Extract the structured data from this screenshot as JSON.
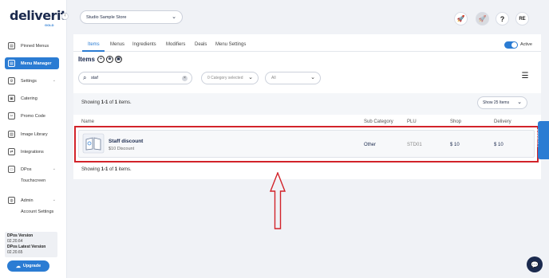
{
  "brand": {
    "name": "deliverit",
    "sub": "GOLD"
  },
  "sidebar": {
    "collapse_icon": "‹",
    "items": [
      {
        "label": "Pinned Menus",
        "icon": "▤"
      },
      {
        "label": "Menu Manager",
        "icon": "▤"
      },
      {
        "label": "Settings",
        "icon": "⚙"
      },
      {
        "label": "Catering",
        "icon": "▣"
      },
      {
        "label": "Promo Code",
        "icon": "✂"
      },
      {
        "label": "Image Library",
        "icon": "▧"
      },
      {
        "label": "Integrations",
        "icon": "⇄"
      },
      {
        "label": "DPos",
        "icon": "▭"
      },
      {
        "label": "Admin",
        "icon": "◍"
      }
    ],
    "subitems": {
      "dpos": "Touchscreen",
      "admin": "Account Settings"
    },
    "chevron": "⌄",
    "version": {
      "label": "DPos Version",
      "value": "02.20.64",
      "latest_label": "DPos Latest Version",
      "latest_value": "02.20.65"
    },
    "upgrade_label": "Upgrade",
    "upgrade_icon": "☁"
  },
  "header": {
    "store": "Studio Sample Store",
    "chevron": "⌄",
    "help": "?",
    "avatar": "RE",
    "rocket_icon": "🚀"
  },
  "tabs": [
    "Items",
    "Menus",
    "Ingredients",
    "Modifiers",
    "Deals",
    "Menu Settings"
  ],
  "active_toggle": {
    "label": "Active",
    "on": true
  },
  "items_title": "Items",
  "items_icons": [
    "+",
    "⊕",
    "▣"
  ],
  "search": {
    "value": "staf",
    "clear": "×",
    "icon": "⌕"
  },
  "filters": {
    "category": "0 Category selected",
    "status": "All"
  },
  "columns_icon": "☰",
  "showing_top": {
    "pre": "Showing ",
    "range": "1-1",
    "mid": " of ",
    "total": "1",
    "post": " items."
  },
  "per_page": "Show 25 Items",
  "table": {
    "headers": {
      "name": "Name",
      "sub_category": "Sub Category",
      "plu": "PLU",
      "shop": "Shop",
      "delivery": "Delivery"
    },
    "rows": [
      {
        "name": "Staff discount",
        "desc": "$10 Discount",
        "sub_category": "Other",
        "plu": "STD01",
        "shop": "$ 10",
        "delivery": "$ 10"
      }
    ]
  },
  "showing_bottom": {
    "pre": "Showing ",
    "range": "1-1",
    "mid": " of ",
    "total": "1",
    "post": " items."
  },
  "feedback_label": "Feedback",
  "chat_icon": "💬",
  "colors": {
    "accent": "#2b7cd3",
    "highlight": "#d2232a",
    "navy": "#1b2a4e"
  }
}
